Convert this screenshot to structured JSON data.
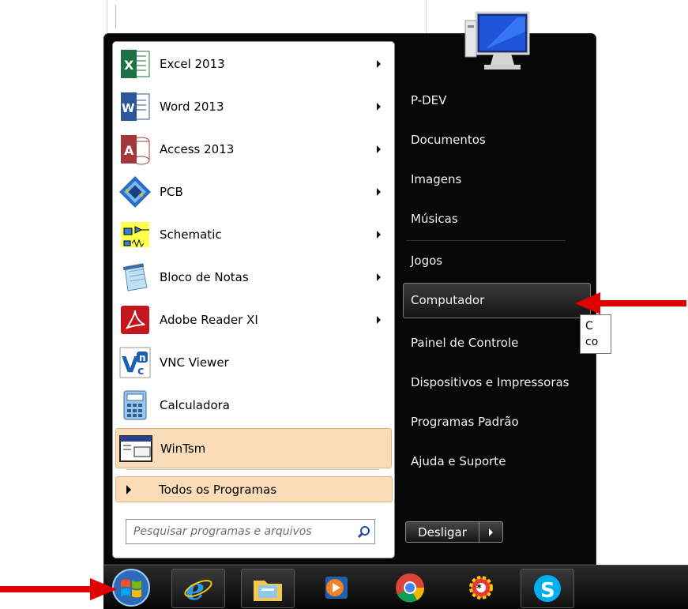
{
  "programs": [
    {
      "label": "Excel 2013",
      "icon": "excel-icon",
      "has_submenu": true
    },
    {
      "label": "Word 2013",
      "icon": "word-icon",
      "has_submenu": true
    },
    {
      "label": "Access 2013",
      "icon": "access-icon",
      "has_submenu": true
    },
    {
      "label": "PCB",
      "icon": "pcb-icon",
      "has_submenu": true
    },
    {
      "label": "Schematic",
      "icon": "schematic-icon",
      "has_submenu": true
    },
    {
      "label": "Bloco de Notas",
      "icon": "notepad-icon",
      "has_submenu": true
    },
    {
      "label": "Adobe Reader XI",
      "icon": "adobe-reader-icon",
      "has_submenu": true
    },
    {
      "label": "VNC Viewer",
      "icon": "vnc-icon",
      "has_submenu": false
    },
    {
      "label": "Calculadora",
      "icon": "calculator-icon",
      "has_submenu": false
    },
    {
      "label": "WinTsm",
      "icon": "wintsm-icon",
      "has_submenu": false,
      "highlighted": true
    }
  ],
  "all_programs": "Todos os Programas",
  "search": {
    "placeholder": "Pesquisar programas e arquivos"
  },
  "right_panel": {
    "items": [
      {
        "label": "P-DEV"
      },
      {
        "label": "Documentos"
      },
      {
        "label": "Imagens"
      },
      {
        "label": "Músicas"
      },
      {
        "label": "Jogos"
      },
      {
        "label": "Computador",
        "highlighted": true
      },
      {
        "label": "Painel de Controle"
      },
      {
        "label": "Dispositivos e Impressoras"
      },
      {
        "label": "Programas Padrão"
      },
      {
        "label": "Ajuda e Suporte"
      }
    ],
    "tooltip_lines": [
      "C",
      "co"
    ]
  },
  "shutdown": {
    "label": "Desligar"
  },
  "taskbar": {
    "items": [
      "start-orb-icon",
      "internet-explorer-icon",
      "file-explorer-icon",
      "media-player-icon",
      "chrome-icon",
      "settings-gear-icon",
      "skype-icon"
    ]
  },
  "annotations": {
    "arrow_color": "#e00000"
  }
}
